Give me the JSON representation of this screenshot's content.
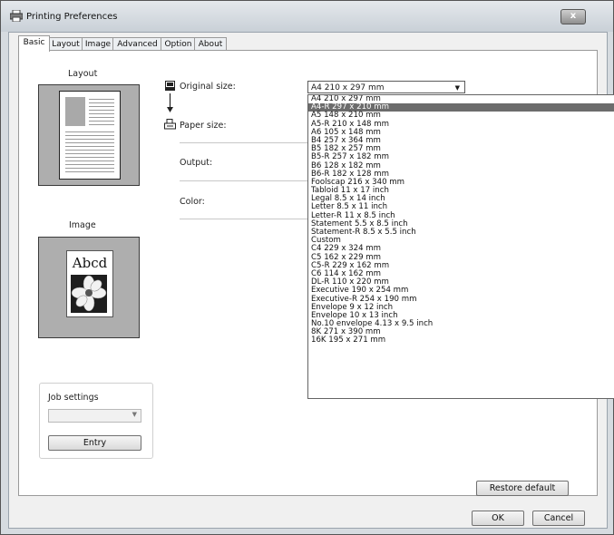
{
  "window": {
    "title": "Printing Preferences",
    "close_glyph": "x"
  },
  "tabs": [
    "Basic",
    "Layout",
    "Image",
    "Advanced",
    "Option",
    "About"
  ],
  "left": {
    "layout_label": "Layout",
    "image_label": "Image",
    "image_sample_text": "Abcd",
    "job_settings_label": "Job settings",
    "entry_button": "Entry"
  },
  "fields": {
    "original_size_label": "Original size:",
    "paper_size_label": "Paper size:",
    "output_label": "Output:",
    "color_label": "Color:"
  },
  "combo": {
    "selected_value": "A4 210 x 297 mm"
  },
  "dropdown": {
    "highlighted_index": 1,
    "options": [
      "A4 210 x 297 mm",
      "A4-R 297 x 210 mm",
      "A5 148 x 210 mm",
      "A5-R 210 x 148 mm",
      "A6 105 x 148 mm",
      "B4 257 x 364 mm",
      "B5 182 x 257 mm",
      "B5-R 257 x 182 mm",
      "B6 128 x 182 mm",
      "B6-R 182 x 128 mm",
      "Foolscap 216 x 340 mm",
      "Tabloid 11 x 17 inch",
      "Legal 8.5 x 14 inch",
      "Letter 8.5 x 11 inch",
      "Letter-R 11 x 8.5 inch",
      "Statement 5.5 x 8.5 inch",
      "Statement-R 8.5 x 5.5 inch",
      "Custom",
      "C4 229 x 324 mm",
      "C5 162 x 229 mm",
      "C5-R 229 x 162 mm",
      "C6 114 x 162 mm",
      "DL-R 110 x 220 mm",
      "Executive 190 x 254 mm",
      "Executive-R 254 x 190 mm",
      "Envelope 9 x 12 inch",
      "Envelope 10 x 13 inch",
      "No.10 envelope 4.13 x 9.5 inch",
      "8K 271 x 390 mm",
      "16K 195 x 271 mm"
    ]
  },
  "buttons": {
    "restore_default": "Restore default",
    "ok": "OK",
    "cancel": "Cancel"
  },
  "icons": {
    "printer": "printer-icon",
    "original": "original-size-icon",
    "paper": "paper-size-icon",
    "arrow_down": "down-arrow-icon"
  }
}
